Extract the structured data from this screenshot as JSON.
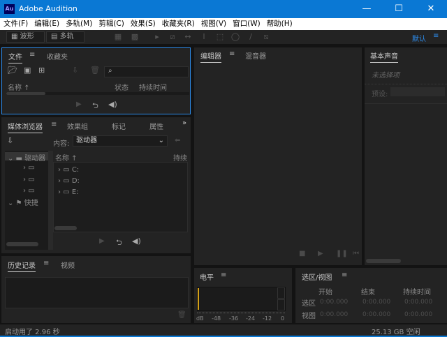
{
  "window": {
    "title": "Adobe Audition",
    "logo": "Au",
    "minimize": "—",
    "maximize": "☐",
    "close": "✕"
  },
  "menu": [
    "文件(F)",
    "编辑(E)",
    "多轨(M)",
    "剪辑(C)",
    "效果(S)",
    "收藏夹(R)",
    "视图(V)",
    "窗口(W)",
    "帮助(H)"
  ],
  "toolbar": {
    "waveform": "波形",
    "multitrack": "多轨",
    "workspace": "默认"
  },
  "files_panel": {
    "tabs": [
      "文件",
      "收藏夹"
    ],
    "columns": [
      "名称 ↑",
      "状态",
      "持续时间"
    ],
    "search_placeholder": ""
  },
  "media_browser": {
    "tabs": [
      "媒体浏览器",
      "效果组",
      "标记",
      "属性"
    ],
    "more": "»",
    "content_label": "内容:",
    "content_value": "驱动器",
    "tree": [
      "驱动器",
      "快捷"
    ],
    "columns": [
      "名称 ↑",
      "持续"
    ],
    "drives": [
      "C:",
      "D:",
      "E:"
    ]
  },
  "history_panel": {
    "tabs": [
      "历史记录",
      "视频"
    ]
  },
  "status": {
    "left": "启动用了 2.96 秒",
    "right": "25.13 GB 空闲"
  },
  "editor": {
    "tabs": [
      "编辑器",
      "混音器"
    ]
  },
  "essential_sound": {
    "title": "基本声音",
    "no_selection": "未选择项",
    "preset_label": "预设:"
  },
  "levels": {
    "title": "电平",
    "scale": [
      "dB",
      "-48",
      "-36",
      "-24",
      "-12",
      "0"
    ]
  },
  "selection_view": {
    "title": "选区/视图",
    "columns": [
      "开始",
      "结束",
      "持续时间"
    ],
    "rows": [
      {
        "label": "选区",
        "values": [
          "0:00.000",
          "0:00.000",
          "0:00.000"
        ]
      },
      {
        "label": "视图",
        "values": [
          "0:00.000",
          "0:00.000",
          "0:00.000"
        ]
      }
    ]
  },
  "colors": {
    "titlebar": "#0a78d4",
    "accent": "#2d8ceb",
    "level_marker": "#d4a017"
  }
}
